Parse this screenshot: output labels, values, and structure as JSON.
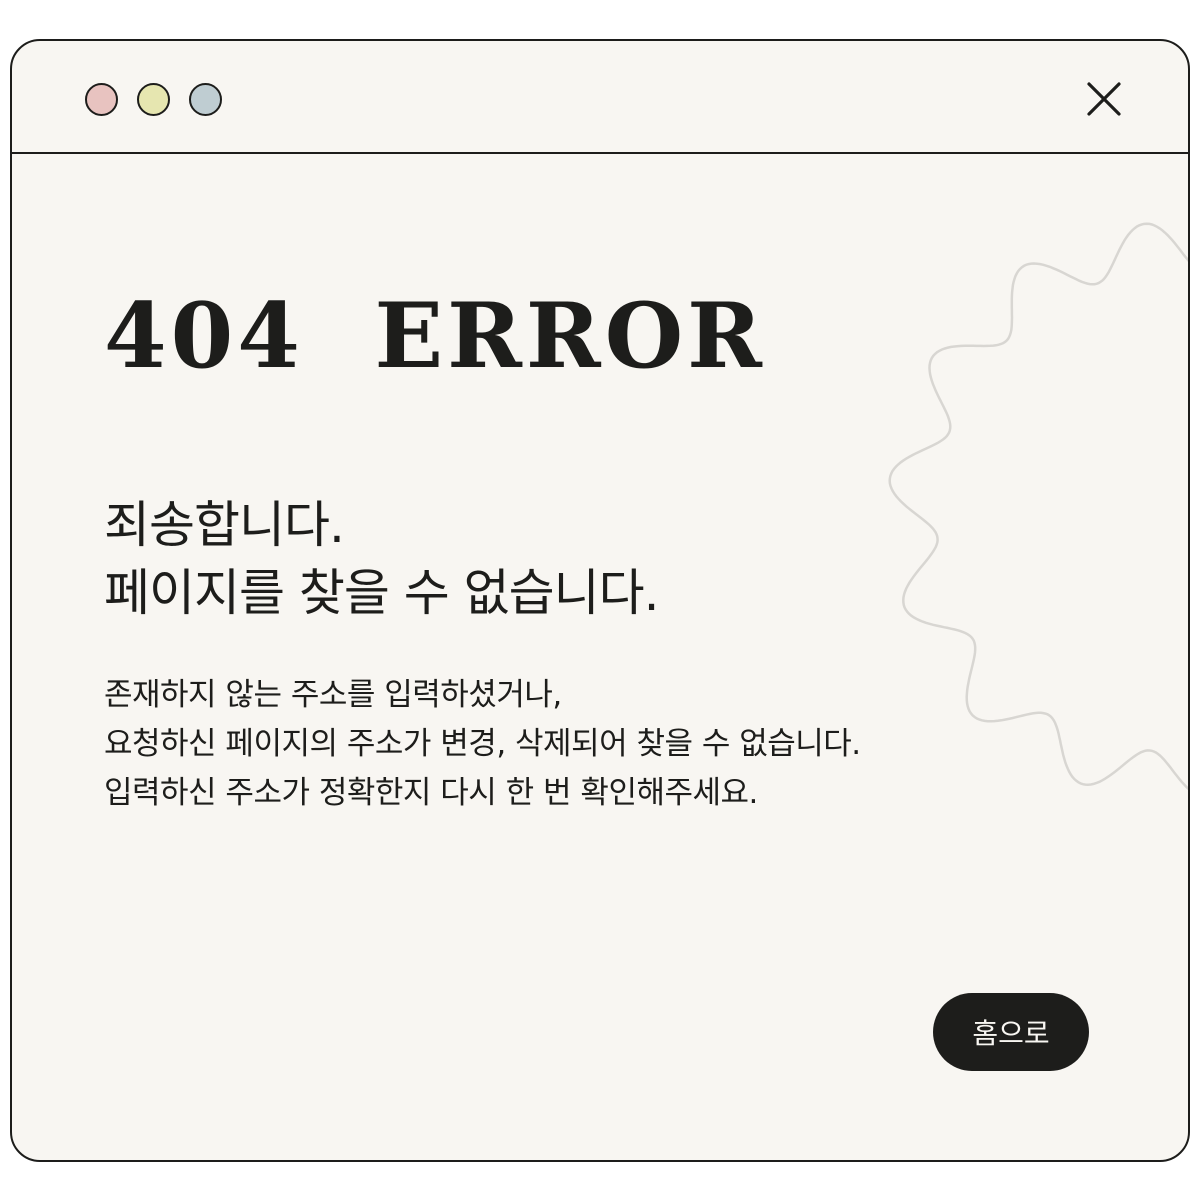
{
  "window": {
    "controls": [
      {
        "name": "close-dot",
        "color": "#e8c3c0"
      },
      {
        "name": "minimize-dot",
        "color": "#e6e6b0"
      },
      {
        "name": "maximize-dot",
        "color": "#bfcdd2"
      }
    ],
    "close_icon": "close-icon"
  },
  "error": {
    "headline": "404  ERROR",
    "title_lines": [
      "죄송합니다.",
      "페이지를 찾을 수 없습니다."
    ],
    "description_lines": [
      "존재하지 않는 주소를 입력하셨거나,",
      "요청하신 페이지의 주소가 변경, 삭제되어 찾을 수 없습니다.",
      "입력하신 주소가 정확한지 다시 한 번 확인해주세요."
    ],
    "home_button_label": "홈으로"
  },
  "colors": {
    "background": "#f8f6f2",
    "ink": "#1d1d1b",
    "squiggle": "#d8d6d2"
  }
}
